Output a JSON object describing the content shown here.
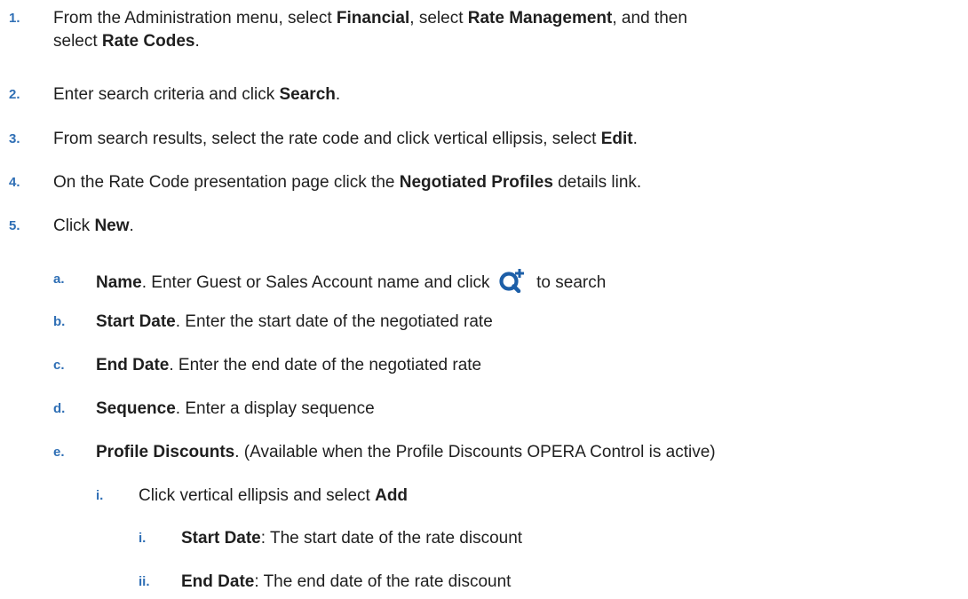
{
  "steps": [
    {
      "marker": "1.",
      "parts": [
        "From the Administration menu, select ",
        "Financial",
        ", select ",
        "Rate Management",
        ", and then"
      ],
      "line2": [
        "select ",
        "Rate Codes",
        "."
      ]
    },
    {
      "marker": "2.",
      "parts": [
        "Enter search criteria and click ",
        "Search",
        "."
      ]
    },
    {
      "marker": "3.",
      "parts": [
        "From search results, select the rate code and click vertical ellipsis, select ",
        "Edit",
        "."
      ]
    },
    {
      "marker": "4.",
      "parts": [
        "On the Rate Code presentation page click the ",
        "Negotiated Profiles",
        " details link."
      ]
    },
    {
      "marker": "5.",
      "parts": [
        "Click ",
        "New",
        "."
      ]
    }
  ],
  "substeps": [
    {
      "marker": "a.",
      "label": "Name",
      "text": ". Enter Guest or Sales Account name and click ",
      "text_after": " to search",
      "icon": "search-plus-icon"
    },
    {
      "marker": "b.",
      "label": "Start Date",
      "text": ". Enter the start date of the negotiated rate"
    },
    {
      "marker": "c.",
      "label": "End Date",
      "text": ". Enter the end date of the negotiated rate"
    },
    {
      "marker": "d.",
      "label": "Sequence",
      "text": ". Enter a display sequence"
    },
    {
      "marker": "e.",
      "label": "Profile Discounts",
      "text": ". (Available when the Profile Discounts OPERA Control is active)"
    }
  ],
  "subsubsteps": [
    {
      "marker": "i.",
      "text": "Click vertical ellipsis and select ",
      "label": "Add"
    }
  ],
  "level4": [
    {
      "marker": "i.",
      "label": "Start Date",
      "text": ": The start date of the rate discount"
    },
    {
      "marker": "ii.",
      "label": "End Date",
      "text": ": The end date of the rate discount"
    }
  ],
  "colors": {
    "marker": "#2f6fb5",
    "icon": "#1d5fa8",
    "text": "#1f1f1f"
  }
}
